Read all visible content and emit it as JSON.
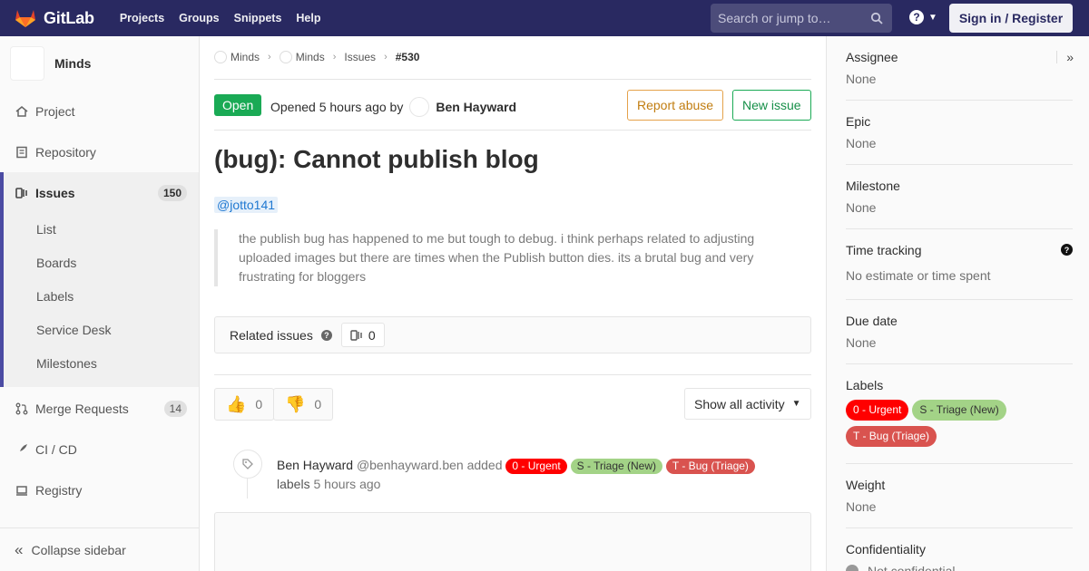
{
  "navbar": {
    "brand": "GitLab",
    "links": [
      "Projects",
      "Groups",
      "Snippets",
      "Help"
    ],
    "search_placeholder": "Search or jump to…",
    "signin": "Sign in / Register"
  },
  "sidebar": {
    "project_name": "Minds",
    "items": [
      {
        "label": "Project",
        "icon": "home-icon"
      },
      {
        "label": "Repository",
        "icon": "doc-icon"
      },
      {
        "label": "Issues",
        "icon": "issues-icon",
        "count": "150"
      },
      {
        "label": "Merge Requests",
        "icon": "merge-icon",
        "count": "14"
      },
      {
        "label": "CI / CD",
        "icon": "rocket-icon"
      },
      {
        "label": "Registry",
        "icon": "container-icon"
      }
    ],
    "issues_sub": [
      "List",
      "Boards",
      "Labels",
      "Service Desk",
      "Milestones"
    ],
    "collapse": "Collapse sidebar"
  },
  "breadcrumb": [
    "Minds",
    "Minds",
    "Issues",
    "#530"
  ],
  "issue": {
    "status": "Open",
    "opened_text": "Opened 5 hours ago by",
    "author": "Ben Hayward",
    "report_abuse": "Report abuse",
    "new_issue": "New issue",
    "title": "(bug): Cannot publish blog",
    "mention": "@jotto141",
    "description": "the publish bug has happened to me but tough to debug. i think perhaps related to adjusting uploaded images but there are times when the Publish button dies. its a brutal bug and very frustrating for bloggers",
    "related_label": "Related issues",
    "related_count": "0",
    "thumbs_up": "0",
    "thumbs_down": "0",
    "activity": "Show all activity"
  },
  "note": {
    "author": "Ben Hayward",
    "handle": "@benhayward.ben",
    "action": "added",
    "labels_word": "labels",
    "time": "5 hours ago"
  },
  "labels": {
    "urgent": "0 - Urgent",
    "triage": "S - Triage (New)",
    "bug": "T - Bug (Triage)",
    "colors": {
      "urgent": "#ff0000",
      "triage": "#a3d387",
      "bug": "#d9534f"
    }
  },
  "right_sidebar": {
    "assignee_title": "Assignee",
    "assignee_value": "None",
    "epic_title": "Epic",
    "epic_value": "None",
    "milestone_title": "Milestone",
    "milestone_value": "None",
    "time_title": "Time tracking",
    "time_value": "No estimate or time spent",
    "due_title": "Due date",
    "due_value": "None",
    "labels_title": "Labels",
    "weight_title": "Weight",
    "weight_value": "None",
    "conf_title": "Confidentiality",
    "conf_value": "Not confidential"
  }
}
